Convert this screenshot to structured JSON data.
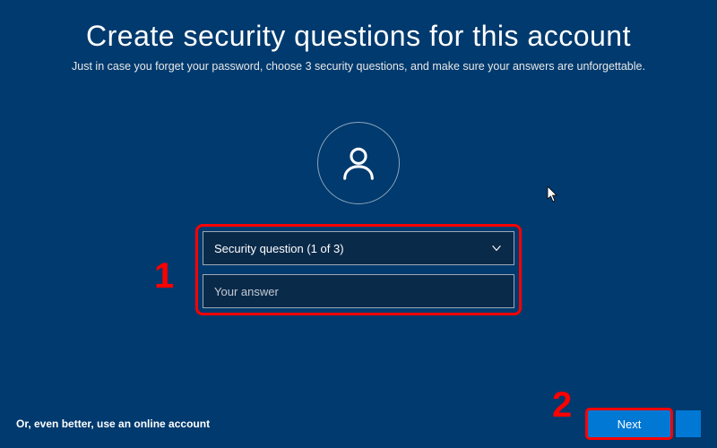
{
  "header": {
    "title": "Create security questions for this account",
    "subtitle": "Just in case you forget your password, choose 3 security questions, and make sure your answers are unforgettable."
  },
  "form": {
    "question_select": {
      "placeholder": "Security question (1 of 3)"
    },
    "answer_input": {
      "placeholder": "Your answer",
      "value": ""
    }
  },
  "footer": {
    "online_account_link": "Or, even better, use an online account",
    "next_button": "Next"
  },
  "annotations": {
    "label_1": "1",
    "label_2": "2"
  },
  "colors": {
    "background": "#003a6e",
    "accent": "#0078d4",
    "highlight": "#ff0000"
  }
}
